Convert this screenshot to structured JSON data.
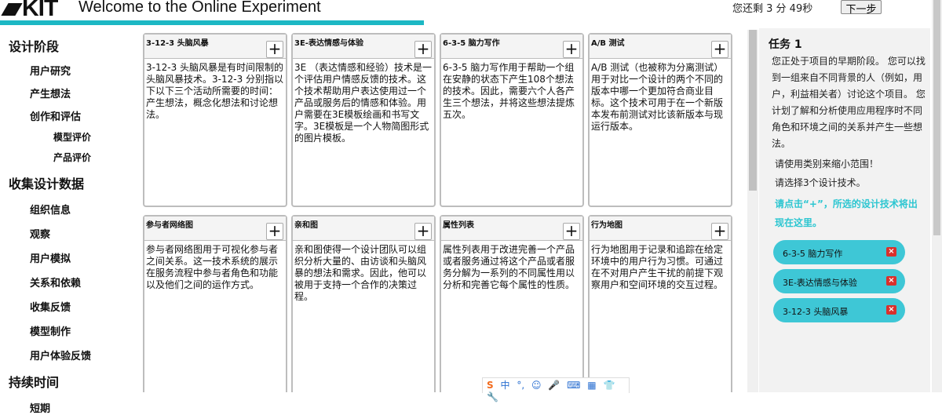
{
  "header": {
    "logo_text": "KIT",
    "title": "Welcome to the Online Experiment",
    "timer": "您还剩 3 分 49秒",
    "next_label": "下一步",
    "accent_color": "#1cb8c4"
  },
  "nav": {
    "section1": "设计阶段",
    "s1_items": [
      "用户研究",
      "产生想法",
      "创作和评估"
    ],
    "s1_sub": [
      "模型评价",
      "产品评价"
    ],
    "section2": "收集设计数据",
    "s2_items": [
      "组织信息",
      "观察",
      "用户模拟",
      "关系和依赖",
      "收集反馈",
      "模型制作",
      "用户体验反馈"
    ],
    "section3": "持续时间",
    "s3_items": [
      "短期"
    ]
  },
  "cards": [
    {
      "title": "3-12-3 头脑风暴",
      "desc": "3-12-3 头脑风暴是有时间限制的头脑风暴技术。3-12-3 分别指以下以下三个活动所需要的时间：产生想法，概念化想法和讨论想法。"
    },
    {
      "title": "3E-表达情感与体验",
      "desc": "3E （表达情感和经验）技术是一个评估用户情感反馈的技术。这个技术帮助用户表达使用过一个产品或服务后的情感和体验。用户需要在3E模板绘画和书写文字。3E模板是一个人物简图形式的图片模板。"
    },
    {
      "title": "6-3-5 脑力写作",
      "desc": "6-3-5 脑力写作用于帮助一个组在安静的状态下产生108个想法的技术。因此，需要六个人各产生三个想法，并将这些想法提炼五次。"
    },
    {
      "title": "A/B 测试",
      "desc": "A/B 测试（也被称为分离测试）用于对比一个设计的两个不同的版本中哪一个更加符合商业目标。这个技术可用于在一个新版本发布前测试对比该新版本与现运行版本。"
    },
    {
      "title": "参与者网络图",
      "desc": "参与者网络图用于可视化参与者之间关系。这一技术系统的展示在服务流程中参与者角色和功能以及他们之间的运作方式。"
    },
    {
      "title": "亲和图",
      "desc": "亲和图使得一个设计团队可以组织分析大量的、由访谈和头脑风暴的想法和需求。因此，他可以被用于支持一个合作的决策过程。"
    },
    {
      "title": "属性列表",
      "desc": "属性列表用于改进完善一个产品或者服务通过将这个产品或者服务分解为一系列的不同属性用以分析和完善它每个属性的性质。"
    },
    {
      "title": "行为地图",
      "desc": "行为地图用于记录和追踪在给定环境中的用户行为习惯。可通过在不对用户产生干扰的前提下观察用户和空间环境的交互过程。"
    }
  ],
  "add_symbol": "+",
  "task": {
    "title": "任务 1",
    "description": "您正处于项目的早期阶段。 您可以找到一组来自不同背景的人（例如，用户，利益相关者）讨论这个项目。 您计划了解和分析使用应用程序时不同角色和环境之间的关系并产生一些想法。",
    "instruction1": "请使用类别来缩小范围！",
    "instruction2": "请选择3个设计技术。",
    "hint": "请点击“+”，所选的设计技术将出现在这里。",
    "selected": [
      "6-3-5 脑力写作",
      "3E-表达情感与体验",
      "3-12-3 头脑风暴"
    ],
    "chip_color": "#3ec7d6",
    "close_symbol": "×"
  },
  "ime": {
    "logo": "S",
    "mode": "中",
    "punct": "°,",
    "emoji": "☺",
    "mic": "🎤",
    "keyboard": "⌨",
    "grid": "▦",
    "shirt": "👕",
    "tool": "🔧"
  }
}
